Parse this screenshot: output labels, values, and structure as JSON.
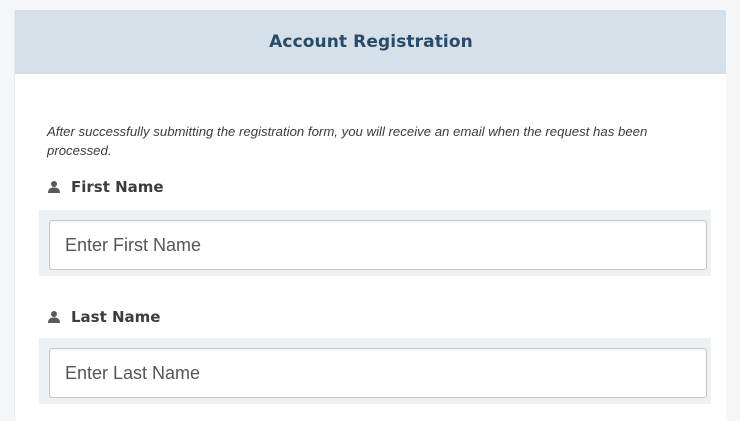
{
  "form": {
    "title": "Account Registration",
    "intro": "After successfully submitting the registration form, you will receive an email when the request has been processed.",
    "fields": [
      {
        "label": "First Name",
        "placeholder": "Enter First Name",
        "icon": "user-icon",
        "value": ""
      },
      {
        "label": "Last Name",
        "placeholder": "Enter Last Name",
        "icon": "user-icon",
        "value": ""
      }
    ]
  },
  "colors": {
    "header_bg": "#d6e0e8",
    "title": "#2a4a68",
    "label": "#3d3d3d",
    "input_well": "#edf1f4"
  }
}
